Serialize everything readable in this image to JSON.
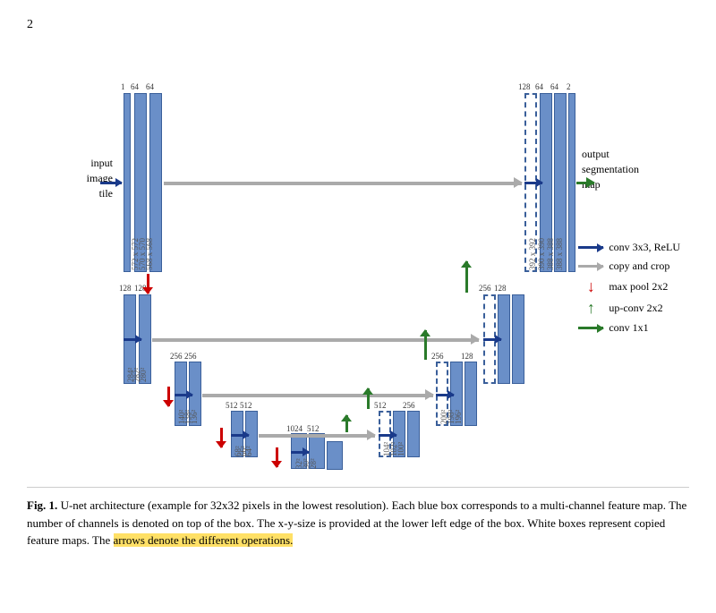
{
  "page": {
    "number": "2"
  },
  "legend": {
    "items": [
      {
        "id": "conv3x3",
        "label": "conv 3x3, ReLU",
        "type": "blue-arrow"
      },
      {
        "id": "copy-crop",
        "label": "copy and crop",
        "type": "gray-arrow"
      },
      {
        "id": "maxpool",
        "label": "max pool 2x2",
        "type": "red-down"
      },
      {
        "id": "upconv",
        "label": "up-conv 2x2",
        "type": "green-up"
      },
      {
        "id": "conv1x1",
        "label": "conv 1x1",
        "type": "green-arrow"
      }
    ]
  },
  "caption": {
    "bold_part": "Fig. 1.",
    "text": " U-net architecture (example for 32x32 pixels in the lowest resolution). Each blue box corresponds to a multi-channel feature map. The number of channels is denoted on top of the box. The x-y-size is provided at the lower left edge of the box. White boxes represent copied feature maps. The ",
    "highlighted": "arrows denote the different operations.",
    "period": ""
  },
  "labels": {
    "input_image": "input\nimage\ntile",
    "output_seg": "output\nsegmentation\nmap"
  }
}
